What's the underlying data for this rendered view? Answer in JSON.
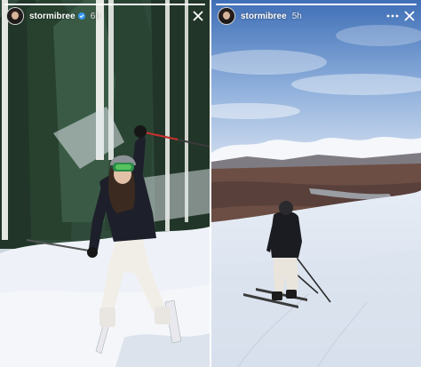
{
  "stories": [
    {
      "username": "stormibree",
      "time": "6h",
      "progress": 1.0,
      "icons": {
        "avatar": "avatar-icon",
        "verified": "verified-badge-icon",
        "close": "close-icon"
      }
    },
    {
      "username": "stormibree",
      "time": "5h",
      "progress": 1.0,
      "icons": {
        "avatar": "avatar-icon",
        "more": "more-icon",
        "close": "close-icon"
      }
    }
  ],
  "colors": {
    "header_text": "#ffffff",
    "sky": "#6d93cc",
    "snow": "#eef2f8",
    "forest": "#24382d",
    "jacket": "#1d1f2a"
  }
}
